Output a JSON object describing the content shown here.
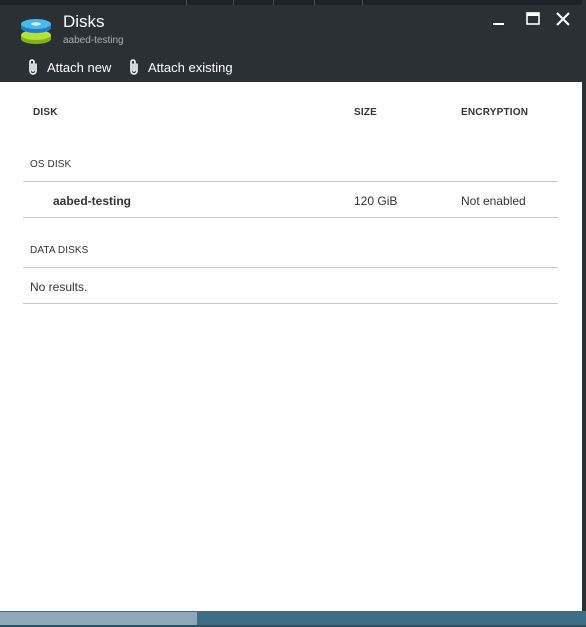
{
  "blade": {
    "title": "Disks",
    "subtitle": "aabed-testing"
  },
  "toolbar": {
    "attach_new_label": "Attach new",
    "attach_existing_label": "Attach existing"
  },
  "window_controls": [
    "minimize-icon",
    "maximize-icon",
    "close-icon"
  ],
  "table": {
    "columns": [
      "DISK",
      "SIZE",
      "ENCRYPTION"
    ],
    "os_disk": {
      "label": "OS DISK",
      "rows": [
        {
          "disk": "aabed-testing",
          "size": "120 GiB",
          "encryption": "Not enabled"
        }
      ]
    },
    "data_disks": {
      "label": "DATA DISKS",
      "empty_text": "No results."
    }
  },
  "colors": {
    "header_bg": "#2b3035",
    "scrollbar_track": "#3d6e85",
    "scrollbar_thumb": "#8fa8b8",
    "divider": "#c8c8c8"
  }
}
